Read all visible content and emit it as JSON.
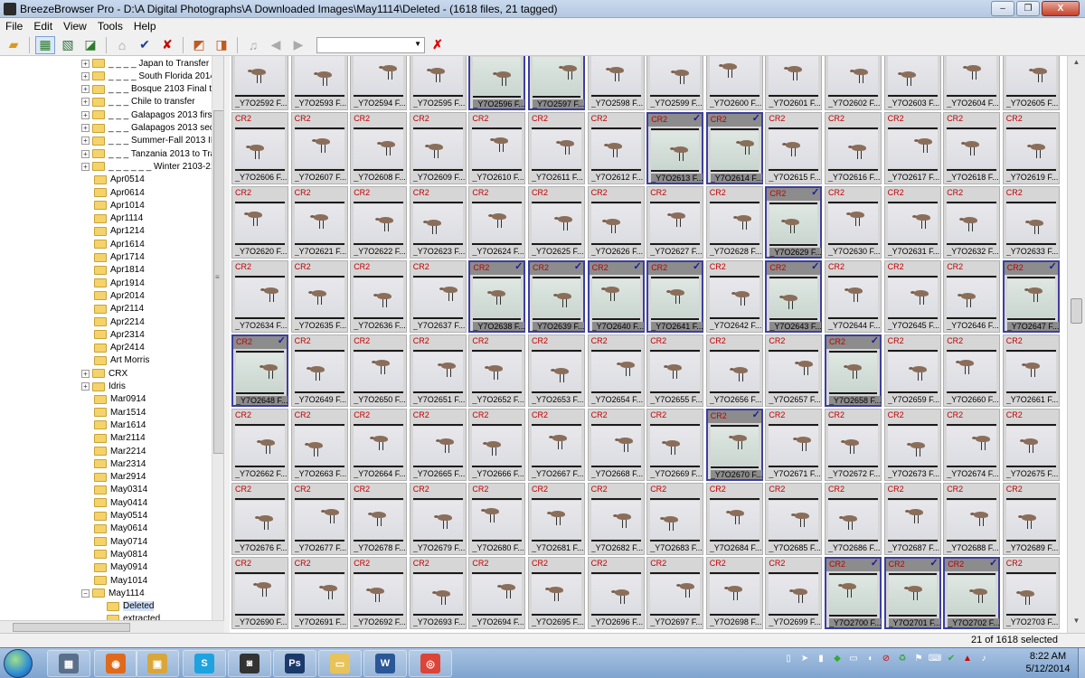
{
  "window": {
    "title": "BreezeBrowser Pro - D:\\A Digital Photographs\\A Downloaded Images\\May1114\\Deleted - (1618 files, 21 tagged)",
    "buttons": {
      "minimize": "–",
      "maximize": "❐",
      "close": "X"
    }
  },
  "menu": [
    "File",
    "Edit",
    "View",
    "Tools",
    "Help"
  ],
  "toolbar": {
    "icons": [
      "open-folder-icon",
      "thumbnail-grid-icon",
      "thumbnail-detail-icon",
      "image-view-icon",
      "slideshow-icon",
      "tag-check-icon",
      "untag-icon",
      "rotate-left-icon",
      "rotate-right-icon",
      "sound-icon",
      "back-arrow-icon",
      "forward-arrow-icon",
      "delete-icon"
    ],
    "dropdown_value": ""
  },
  "tree": {
    "items": [
      {
        "label": "_ _ _ _ Japan to Transfer",
        "level": 0,
        "expander": "+"
      },
      {
        "label": "_ _ _ _ South Florida 2014 IF",
        "level": 0,
        "expander": "+"
      },
      {
        "label": "_ _ _ Bosque 2103 Final to T",
        "level": 0,
        "expander": "+"
      },
      {
        "label": "_ _ _ Chile to transfer",
        "level": 0,
        "expander": "+"
      },
      {
        "label": "_ _ _ Galapagos 2013 first h",
        "level": 0,
        "expander": "+"
      },
      {
        "label": "_ _ _ Galapagos 2013 secc",
        "level": 0,
        "expander": "+"
      },
      {
        "label": "_ _ _ Summer-Fall 2013 ILE",
        "level": 0,
        "expander": "+"
      },
      {
        "label": "_ _ _ Tanzania 2013 to Trar",
        "level": 0,
        "expander": "+"
      },
      {
        "label": "_ _ _ _ _ _ Winter 2103-2104 Lo",
        "level": 0,
        "expander": "+"
      },
      {
        "label": "Apr0514",
        "level": 0,
        "expander": ""
      },
      {
        "label": "Apr0614",
        "level": 0,
        "expander": ""
      },
      {
        "label": "Apr1014",
        "level": 0,
        "expander": ""
      },
      {
        "label": "Apr1114",
        "level": 0,
        "expander": ""
      },
      {
        "label": "Apr1214",
        "level": 0,
        "expander": ""
      },
      {
        "label": "Apr1614",
        "level": 0,
        "expander": ""
      },
      {
        "label": "Apr1714",
        "level": 0,
        "expander": ""
      },
      {
        "label": "Apr1814",
        "level": 0,
        "expander": ""
      },
      {
        "label": "Apr1914",
        "level": 0,
        "expander": ""
      },
      {
        "label": "Apr2014",
        "level": 0,
        "expander": ""
      },
      {
        "label": "Apr2114",
        "level": 0,
        "expander": ""
      },
      {
        "label": "Apr2214",
        "level": 0,
        "expander": ""
      },
      {
        "label": "Apr2314",
        "level": 0,
        "expander": ""
      },
      {
        "label": "Apr2414",
        "level": 0,
        "expander": ""
      },
      {
        "label": "Art Morris",
        "level": 0,
        "expander": ""
      },
      {
        "label": "CRX",
        "level": 0,
        "expander": "+"
      },
      {
        "label": "Idris",
        "level": 0,
        "expander": "+"
      },
      {
        "label": "Mar0914",
        "level": 0,
        "expander": ""
      },
      {
        "label": "Mar1514",
        "level": 0,
        "expander": ""
      },
      {
        "label": "Mar1614",
        "level": 0,
        "expander": ""
      },
      {
        "label": "Mar2114",
        "level": 0,
        "expander": ""
      },
      {
        "label": "Mar2214",
        "level": 0,
        "expander": ""
      },
      {
        "label": "Mar2314",
        "level": 0,
        "expander": ""
      },
      {
        "label": "Mar2914",
        "level": 0,
        "expander": ""
      },
      {
        "label": "May0314",
        "level": 0,
        "expander": ""
      },
      {
        "label": "May0414",
        "level": 0,
        "expander": ""
      },
      {
        "label": "May0514",
        "level": 0,
        "expander": ""
      },
      {
        "label": "May0614",
        "level": 0,
        "expander": ""
      },
      {
        "label": "May0714",
        "level": 0,
        "expander": ""
      },
      {
        "label": "May0814",
        "level": 0,
        "expander": ""
      },
      {
        "label": "May0914",
        "level": 0,
        "expander": ""
      },
      {
        "label": "May1014",
        "level": 0,
        "expander": ""
      },
      {
        "label": "May1114",
        "level": 0,
        "expander": "−"
      },
      {
        "label": "Deleted",
        "level": 1,
        "expander": "",
        "selected": true
      },
      {
        "label": "extracted",
        "level": 1,
        "expander": ""
      }
    ]
  },
  "grid": {
    "columns": 14,
    "first_row_partial": true,
    "file_type_label": "CR2",
    "name_suffix": " F...",
    "rows": [
      {
        "start": 2592,
        "has_type": false,
        "tagged": [
          4,
          5
        ]
      },
      {
        "start": 2606,
        "has_type": true,
        "tagged": [
          7,
          8
        ]
      },
      {
        "start": 2620,
        "has_type": true,
        "tagged": [
          9
        ]
      },
      {
        "start": 2634,
        "has_type": true,
        "tagged": [
          4,
          5,
          6,
          7,
          9,
          13
        ]
      },
      {
        "start": 2648,
        "has_type": true,
        "tagged": [
          0,
          10
        ]
      },
      {
        "start": 2662,
        "has_type": true,
        "tagged": [
          8
        ]
      },
      {
        "start": 2676,
        "has_type": true,
        "tagged": []
      },
      {
        "start": 2690,
        "has_type": true,
        "tagged": [
          10,
          11,
          12
        ]
      }
    ],
    "name_prefix": "_Y7O"
  },
  "status": {
    "text": "21 of 1618 selected"
  },
  "taskbar": {
    "apps": [
      {
        "name": "calculator",
        "glyph": "▦",
        "color": "#5a6f8a"
      },
      {
        "name": "firefox",
        "glyph": "◉",
        "color": "#e06a1c"
      },
      {
        "name": "explorer",
        "glyph": "▣",
        "color": "#d9a63a"
      },
      {
        "name": "skype",
        "glyph": "S",
        "color": "#1ea2e0"
      },
      {
        "name": "camera",
        "glyph": "◙",
        "color": "#333333"
      },
      {
        "name": "photoshop",
        "glyph": "Ps",
        "color": "#1b3a6b"
      },
      {
        "name": "folder",
        "glyph": "▭",
        "color": "#e8c35a"
      },
      {
        "name": "word",
        "glyph": "W",
        "color": "#2b5797"
      },
      {
        "name": "chrome",
        "glyph": "◎",
        "color": "#db4437"
      }
    ],
    "clock_time": "8:22 AM",
    "clock_date": "5/12/2014"
  }
}
